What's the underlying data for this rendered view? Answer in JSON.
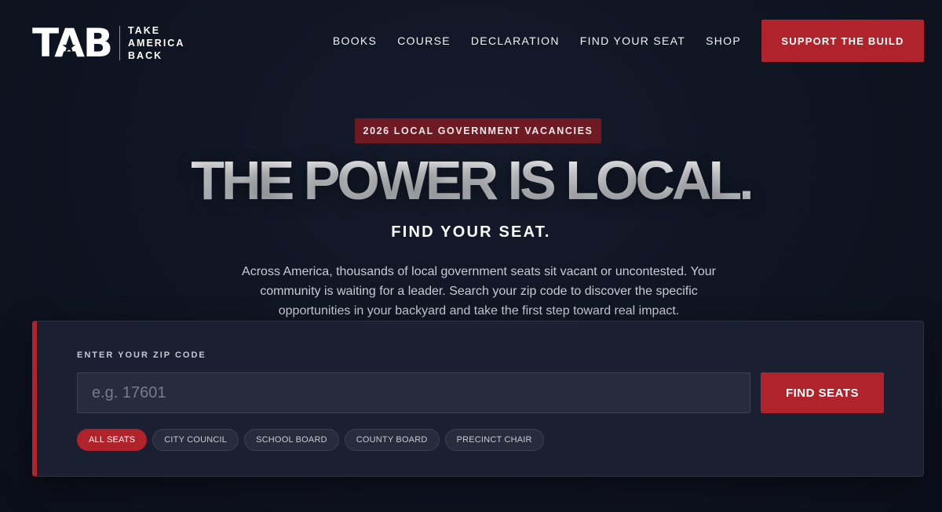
{
  "header": {
    "logo": {
      "mark": "TAB",
      "lines": [
        "TAKE",
        "AMERICA",
        "BACK"
      ]
    },
    "nav": [
      {
        "label": "BOOKS"
      },
      {
        "label": "COURSE"
      },
      {
        "label": "DECLARATION"
      },
      {
        "label": "FIND YOUR SEAT"
      },
      {
        "label": "SHOP"
      }
    ],
    "cta_label": "SUPPORT THE BUILD"
  },
  "hero": {
    "badge": "2026 LOCAL GOVERNMENT VACANCIES",
    "headline": "THE POWER IS LOCAL.",
    "subhead": "FIND YOUR SEAT.",
    "description": "Across America, thousands of local government seats sit vacant or uncontested. Your community is waiting for a leader. Search your zip code to discover the specific opportunities in your backyard and take the first step toward real impact."
  },
  "search": {
    "label": "ENTER YOUR ZIP CODE",
    "placeholder": "e.g. 17601",
    "value": "",
    "button_label": "FIND SEATS",
    "filters": [
      {
        "label": "ALL SEATS",
        "active": true
      },
      {
        "label": "CITY COUNCIL",
        "active": false
      },
      {
        "label": "SCHOOL BOARD",
        "active": false
      },
      {
        "label": "COUNTY BOARD",
        "active": false
      },
      {
        "label": "PRECINCT CHAIR",
        "active": false
      }
    ]
  },
  "colors": {
    "accent": "#b1232b",
    "background": "#0f1422",
    "panel": "#1a2031"
  },
  "icons": {
    "logo_star": "star-icon"
  }
}
